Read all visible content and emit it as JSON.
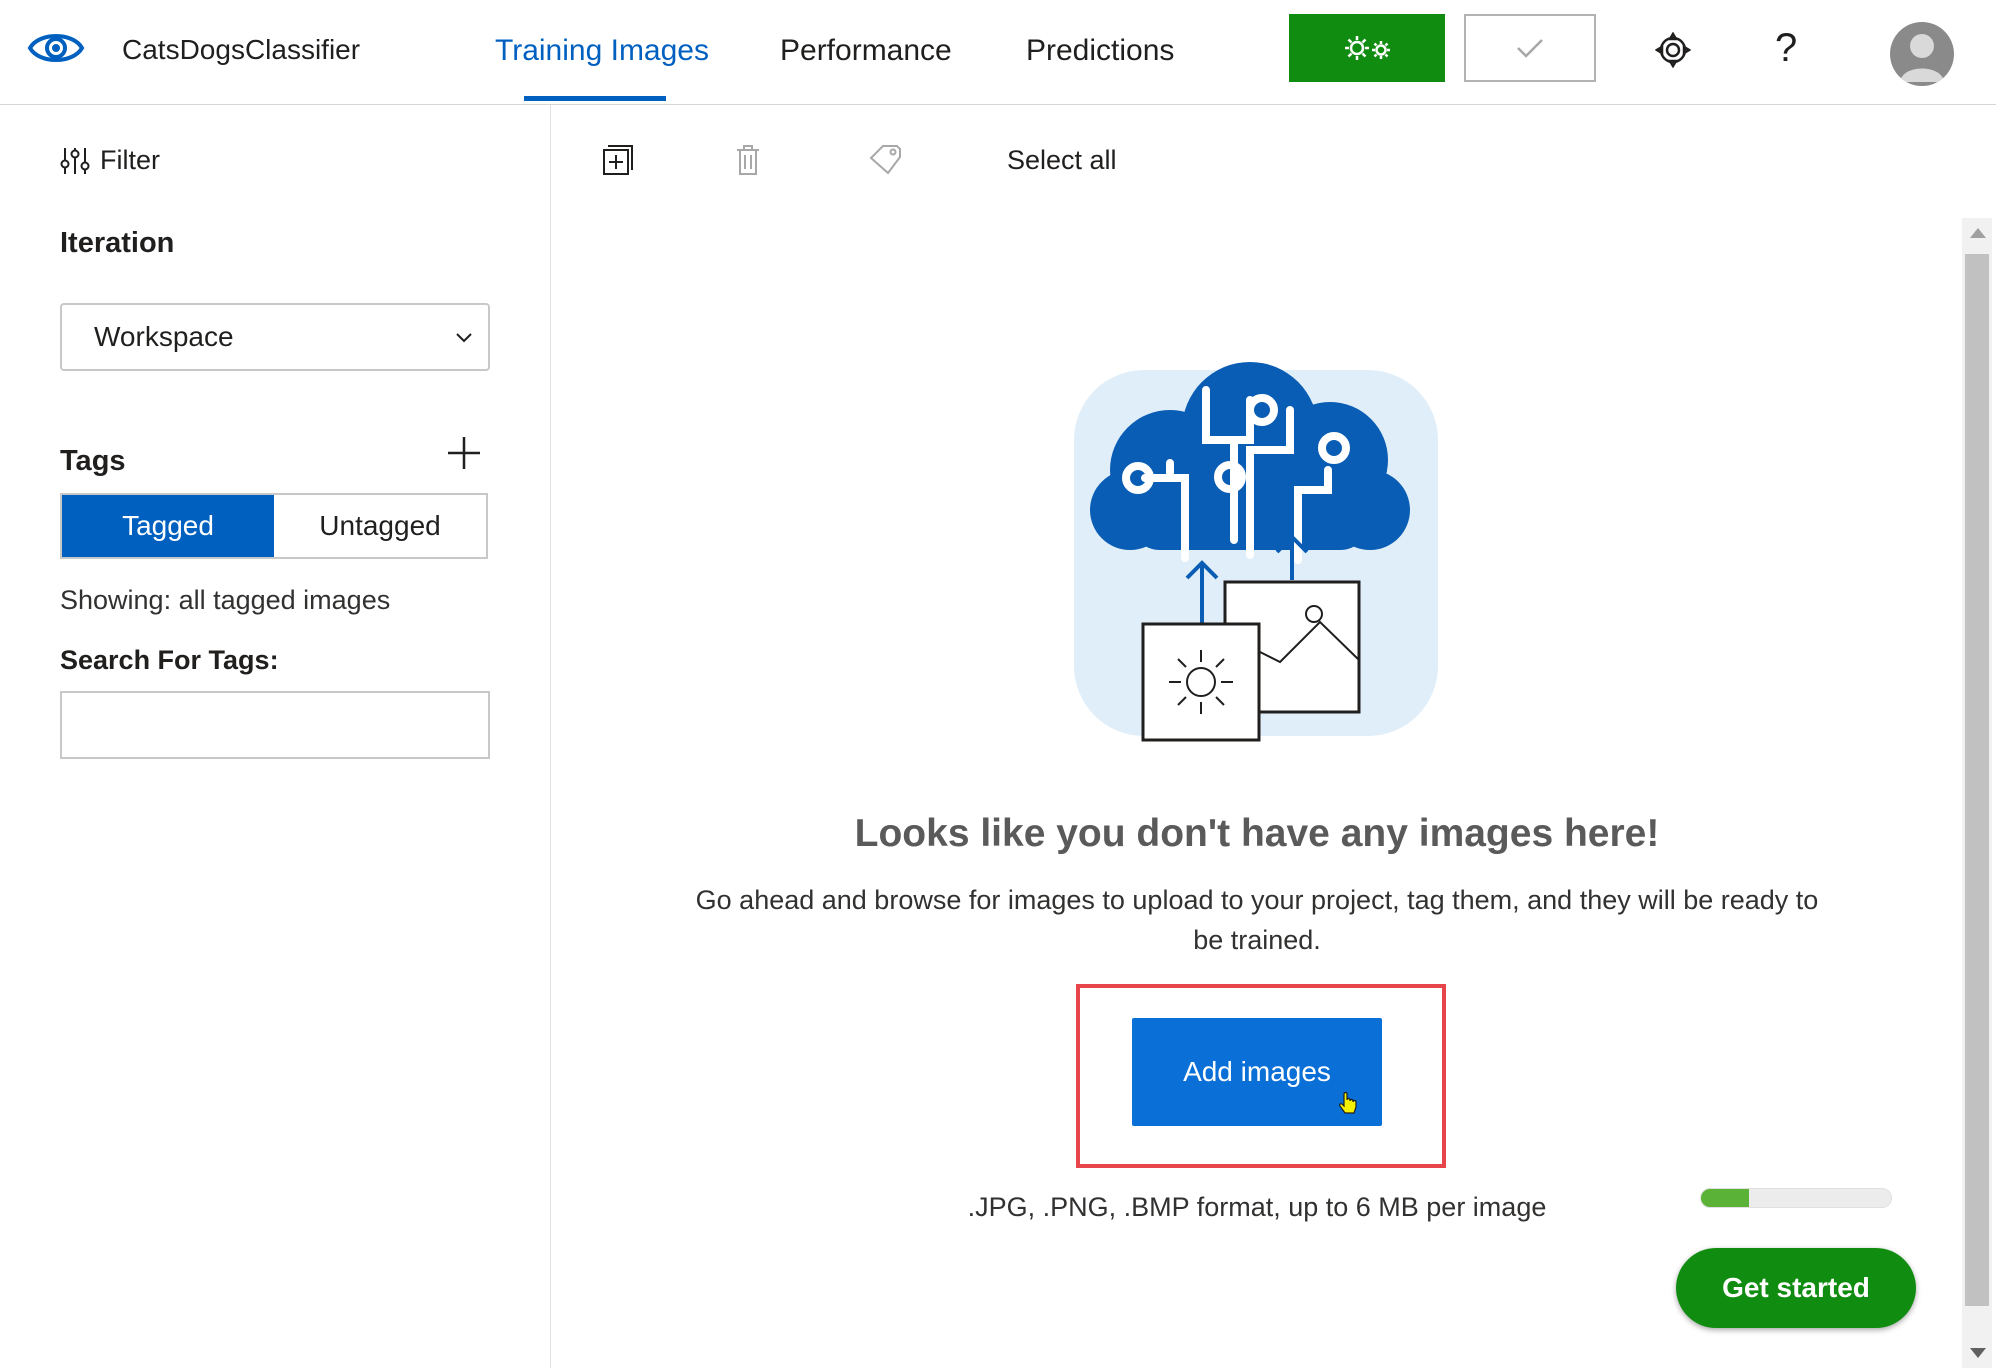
{
  "header": {
    "app_title": "CatsDogsClassifier",
    "tabs": [
      {
        "label": "Training Images",
        "active": true
      },
      {
        "label": "Performance",
        "active": false
      },
      {
        "label": "Predictions",
        "active": false
      }
    ],
    "train_icon": "gears-icon",
    "quick_test_icon": "check-icon",
    "settings_icon": "gear-icon",
    "help_label": "?",
    "avatar_icon": "user-avatar-icon"
  },
  "sidebar": {
    "filter_label": "Filter",
    "iteration_heading": "Iteration",
    "iteration_selected": "Workspace",
    "tags_heading": "Tags",
    "tag_toggle": [
      {
        "label": "Tagged",
        "selected": true
      },
      {
        "label": "Untagged",
        "selected": false
      }
    ],
    "showing_text": "Showing: all tagged images",
    "search_label": "Search For Tags:",
    "search_value": ""
  },
  "toolbar": {
    "icons": [
      "add-image-icon",
      "delete-icon",
      "tag-icon"
    ],
    "select_all_label": "Select all"
  },
  "empty_state": {
    "headline": "Looks like you don't have any images here!",
    "description": "Go ahead and browse for images to upload to your project, tag them, and they will be ready to be trained.",
    "add_button_label": "Add images",
    "formats_text": ".JPG, .PNG, .BMP format, up to 6 MB per image"
  },
  "onboarding": {
    "progress_fraction": 0.25,
    "get_started_label": "Get started"
  },
  "colors": {
    "accent_blue": "#0060c0",
    "button_blue": "#0a6fd6",
    "train_green": "#108d10",
    "highlight_red": "#e8454b",
    "progress_green": "#5ab336"
  }
}
